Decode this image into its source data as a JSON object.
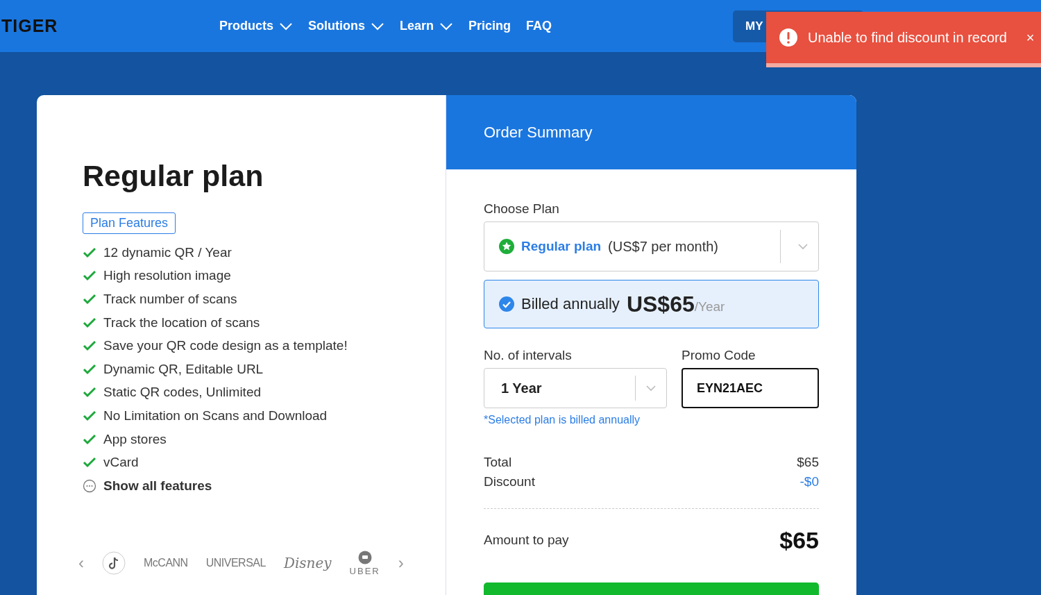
{
  "header": {
    "logo": "TIGER",
    "nav": [
      {
        "label": "Products",
        "dropdown": true
      },
      {
        "label": "Solutions",
        "dropdown": true
      },
      {
        "label": "Learn",
        "dropdown": true
      },
      {
        "label": "Pricing",
        "dropdown": false
      },
      {
        "label": "FAQ",
        "dropdown": false
      }
    ],
    "account_button": "MY"
  },
  "toast": {
    "kind": "error",
    "message": "Unable to find discount in record",
    "close": "×"
  },
  "plan": {
    "title": "Regular plan",
    "features_tag": "Plan Features",
    "features": [
      "12 dynamic QR / Year",
      "High resolution image",
      "Track number of scans",
      "Track the location of scans",
      "Save your QR code design as a template!",
      "Dynamic QR, Editable URL",
      "Static QR codes, Unlimited",
      "No Limitation on Scans and Download",
      "App stores",
      "vCard"
    ],
    "show_all": "Show all features",
    "carousel": {
      "prev": "‹",
      "next": "›",
      "logos": [
        {
          "kind": "icon"
        },
        {
          "kind": "text",
          "text": "McCANN"
        },
        {
          "kind": "text",
          "text": "UNIVERSAL"
        },
        {
          "kind": "script",
          "text": "Disney"
        },
        {
          "kind": "stacked",
          "text": "UBER"
        }
      ]
    }
  },
  "summary": {
    "title": "Order Summary",
    "choose_plan_label": "Choose Plan",
    "plan_select": {
      "name": "Regular plan",
      "price": "(US$7 per month)"
    },
    "billing": {
      "label": "Billed annually",
      "price": "US$65",
      "period": "/Year",
      "selected": true
    },
    "intervals_label": "No. of intervals",
    "intervals_value": "1 Year",
    "promo_label": "Promo Code",
    "promo_value": "EYN21AEC",
    "note": "*Selected plan is billed annually",
    "total_label": "Total",
    "total_value": "$65",
    "discount_label": "Discount",
    "discount_value": "-$0",
    "amount_label": "Amount to pay",
    "amount_value": "$65"
  }
}
